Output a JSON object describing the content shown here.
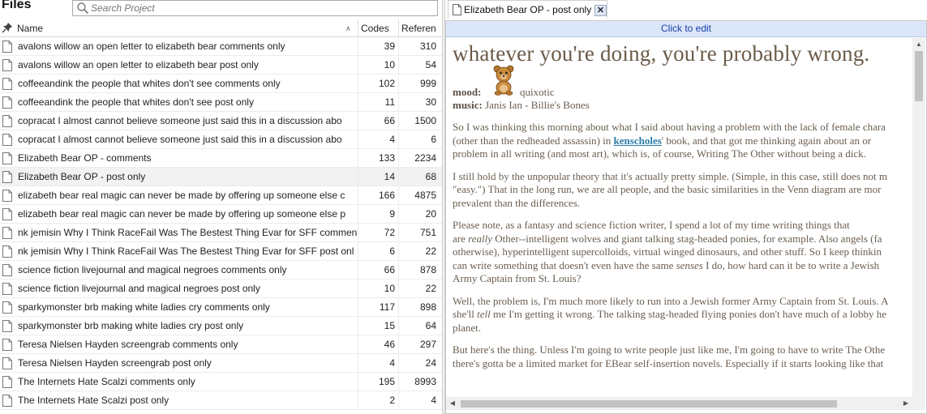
{
  "files_panel": {
    "title": "Files",
    "search_placeholder": "Search Project",
    "columns": {
      "name": "Name",
      "codes": "Codes",
      "references": "Referen"
    },
    "rows": [
      {
        "name": "avalons willow an open letter to elizabeth bear comments only",
        "codes": "39",
        "refs": "310"
      },
      {
        "name": "avalons willow an open letter to elizabeth bear post only",
        "codes": "10",
        "refs": "54"
      },
      {
        "name": "coffeeandink the people that whites don't see comments only",
        "codes": "102",
        "refs": "999"
      },
      {
        "name": "coffeeandink the people that whites don't see post only",
        "codes": "11",
        "refs": "30"
      },
      {
        "name": "copracat I almost cannot believe someone just said this in a discussion abo",
        "codes": "66",
        "refs": "1500"
      },
      {
        "name": "copracat I almost cannot believe someone just said this in a discussion abo",
        "codes": "4",
        "refs": "6"
      },
      {
        "name": "Elizabeth Bear OP - comments",
        "codes": "133",
        "refs": "2234"
      },
      {
        "name": "Elizabeth Bear OP - post only",
        "codes": "14",
        "refs": "68",
        "selected": true
      },
      {
        "name": "elizabeth bear real magic can never be made by offering up someone else c",
        "codes": "166",
        "refs": "4875"
      },
      {
        "name": "elizabeth bear real magic can never be made by offering up someone else p",
        "codes": "9",
        "refs": "20"
      },
      {
        "name": "nk jemisin Why I Think RaceFail Was The Bestest Thing Evar for SFF commen",
        "codes": "72",
        "refs": "751"
      },
      {
        "name": "nk jemisin Why I Think RaceFail Was The Bestest Thing Evar for SFF post onl",
        "codes": "6",
        "refs": "22"
      },
      {
        "name": "science fiction livejournal and magical negroes comments only",
        "codes": "66",
        "refs": "878"
      },
      {
        "name": "science fiction livejournal and magical negroes post only",
        "codes": "10",
        "refs": "22"
      },
      {
        "name": "sparkymonster brb making white ladies cry comments only",
        "codes": "117",
        "refs": "898"
      },
      {
        "name": "sparkymonster brb making white ladies cry post only",
        "codes": "15",
        "refs": "64"
      },
      {
        "name": "Teresa Nielsen Hayden screengrab comments only",
        "codes": "46",
        "refs": "297"
      },
      {
        "name": "Teresa Nielsen Hayden screengrab post only",
        "codes": "4",
        "refs": "24"
      },
      {
        "name": "The Internets Hate Scalzi comments only",
        "codes": "195",
        "refs": "8993"
      },
      {
        "name": "The Internets Hate Scalzi post only",
        "codes": "2",
        "refs": "4"
      }
    ]
  },
  "document": {
    "tab_title": "Elizabeth Bear OP - post only",
    "close_symbol": "✕",
    "edit_bar": "Click to edit",
    "heading": "whatever you're doing, you're probably wrong.",
    "mood_label": "mood:",
    "mood_value": "quixotic",
    "music_label": "music:",
    "music_value": "Janis Ian - Billie's Bones",
    "p1_a": "So I was thinking this morning about what I said about having a problem with the lack of female chara",
    "p1_b_pre": "(other than the redheaded assassin) in ",
    "p1_b_link": "kenscholes",
    "p1_b_post": "' book, and that got me thinking again about an or",
    "p1_c": "problem in all writing (and most art), which is, of course, Writing The Other without being a dick.",
    "p2_a": "I still hold by the unpopular theory that it's actually pretty simple. (Simple, in this case, still does not m",
    "p2_b": "\"easy.\") That in the long run, we are all people, and the basic similarities in the Venn diagram are mor",
    "p2_c": "prevalent than the differences.",
    "p3_a": "Please note, as a fantasy and science fiction writer, I spend a lot of my time writing things that",
    "p3_b_pre": "are ",
    "p3_b_em": "really",
    "p3_b_post": " Other--intelligent wolves and giant talking stag-headed ponies, for example. Also angels (fa",
    "p3_c": "otherwise), hyperintelligent supercolloids, virtual winged dinosaurs, and other stuff. So I keep thinkin",
    "p3_d_pre": "can write something that doesn't even have the same ",
    "p3_d_em": "senses",
    "p3_d_post": " I do, how hard can it be to write a Jewish",
    "p3_e": "Army Captain from St. Louis?",
    "p4_a": "Well, the problem is, I'm much more likely to run into a Jewish former Army Captain from St. Louis. A",
    "p4_b_pre": "she'll ",
    "p4_b_em": "tell",
    "p4_b_post": " me I'm getting it wrong. The talking stag-headed flying ponies don't have much of a lobby he",
    "p4_c": "planet.",
    "p5_a": "But here's the thing. Unless I'm going to write people just like me, I'm going to have to write The Othe",
    "p5_b": "there's gotta be a limited market for EBear self-insertion novels. Especially if it starts looking like that"
  }
}
